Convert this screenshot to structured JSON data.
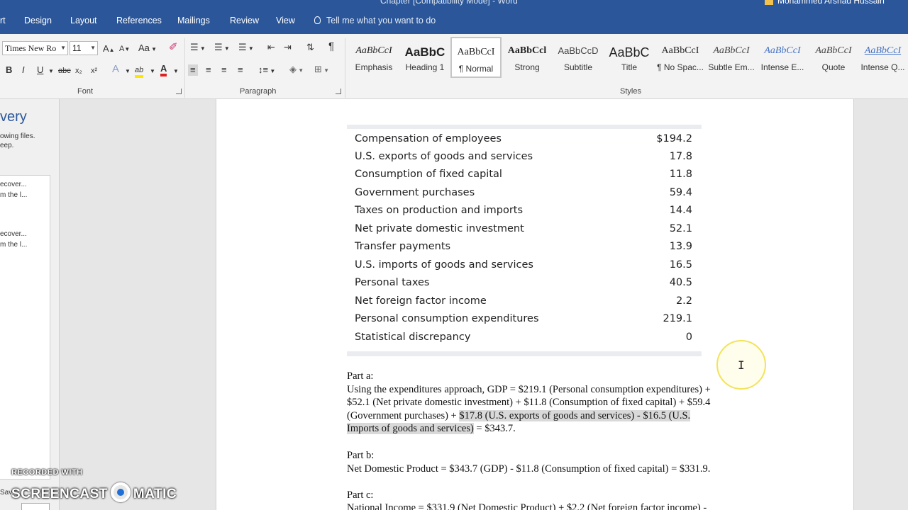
{
  "window": {
    "title": "Chapter [Compatibility Mode] - Word",
    "user": "Mohammed Arshad Hussain"
  },
  "tabs": [
    "rt",
    "Design",
    "Layout",
    "References",
    "Mailings",
    "Review",
    "View"
  ],
  "tell_me": "Tell me what you want to do",
  "font_group": {
    "font_name": "Times New Ro",
    "font_size": "11",
    "label": "Font",
    "grow": "A",
    "shrink": "A",
    "case": "Aa",
    "bold": "B",
    "italic": "I",
    "underline": "U",
    "strike": "abc",
    "subscript": "x₂",
    "superscript": "x²",
    "effects": "A",
    "highlight": "ab",
    "color": "A"
  },
  "paragraph_group": {
    "label": "Paragraph",
    "pilcrow": "¶"
  },
  "styles_group": {
    "label": "Styles",
    "items": [
      {
        "preview": "AaBbCcI",
        "name": "Emphasis"
      },
      {
        "preview": "AaBbC",
        "name": "Heading 1"
      },
      {
        "preview": "AaBbCcI",
        "name": "¶ Normal"
      },
      {
        "preview": "AaBbCcl",
        "name": "Strong"
      },
      {
        "preview": "AaBbCcD",
        "name": "Subtitle"
      },
      {
        "preview": "AaBbC",
        "name": "Title"
      },
      {
        "preview": "AaBbCcI",
        "name": "¶ No Spac..."
      },
      {
        "preview": "AaBbCcI",
        "name": "Subtle Em..."
      },
      {
        "preview": "AaBbCcI",
        "name": "Intense E..."
      },
      {
        "preview": "AaBbCcI",
        "name": "Quote"
      },
      {
        "preview": "AaBbCcI",
        "name": "Intense Q..."
      }
    ]
  },
  "recovery_pane": {
    "heading": "very",
    "desc_line1": "owing files.",
    "desc_line2": "eep.",
    "items": [
      {
        "line1": "ecover...",
        "line2": "m the l..."
      },
      {
        "line1": "ecover...",
        "line2": "m the l..."
      }
    ],
    "bottom_text": "Sav"
  },
  "table": {
    "rows": [
      {
        "label": "Compensation of employees",
        "value": "$194.2"
      },
      {
        "label": "U.S. exports of goods and services",
        "value": "17.8"
      },
      {
        "label": "Consumption of fixed capital",
        "value": "11.8"
      },
      {
        "label": "Government purchases",
        "value": "59.4"
      },
      {
        "label": "Taxes on production and imports",
        "value": "14.4"
      },
      {
        "label": "Net private domestic investment",
        "value": "52.1"
      },
      {
        "label": "Transfer payments",
        "value": "13.9"
      },
      {
        "label": "U.S. imports of goods and services",
        "value": "16.5"
      },
      {
        "label": "Personal taxes",
        "value": "40.5"
      },
      {
        "label": "Net foreign factor income",
        "value": "2.2"
      },
      {
        "label": "Personal consumption expenditures",
        "value": "219.1"
      },
      {
        "label": "Statistical discrepancy",
        "value": "0"
      }
    ]
  },
  "body": {
    "part_a_label": "Part a:",
    "part_a_line1": "Using the expenditures approach, GDP = $219.1 (Personal consumption expenditures) +",
    "part_a_line2": "$52.1 (Net private domestic investment) + $11.8 (Consumption of fixed capital) + $59.4",
    "part_a_line3_plain": "(Government purchases) + ",
    "part_a_line3_hl": "$17.8 (U.S. exports of goods and services) - $16.5 (U.S.",
    "part_a_line4_hl": "Imports of goods and services)",
    "part_a_line4_plain": " = $343.7.",
    "part_b_label": "Part b:",
    "part_b_line1": "Net Domestic Product = $343.7 (GDP) - $11.8 (Consumption of fixed capital) = $331.9.",
    "part_c_label": "Part c:",
    "part_c_line1": "National Income = $331.9 (Net Domestic Product) + $2.2 (Net foreign factor income) -"
  },
  "watermark": {
    "line1": "RECORDED WITH",
    "brand_left": "SCREENCAST",
    "brand_right": "MATIC"
  }
}
